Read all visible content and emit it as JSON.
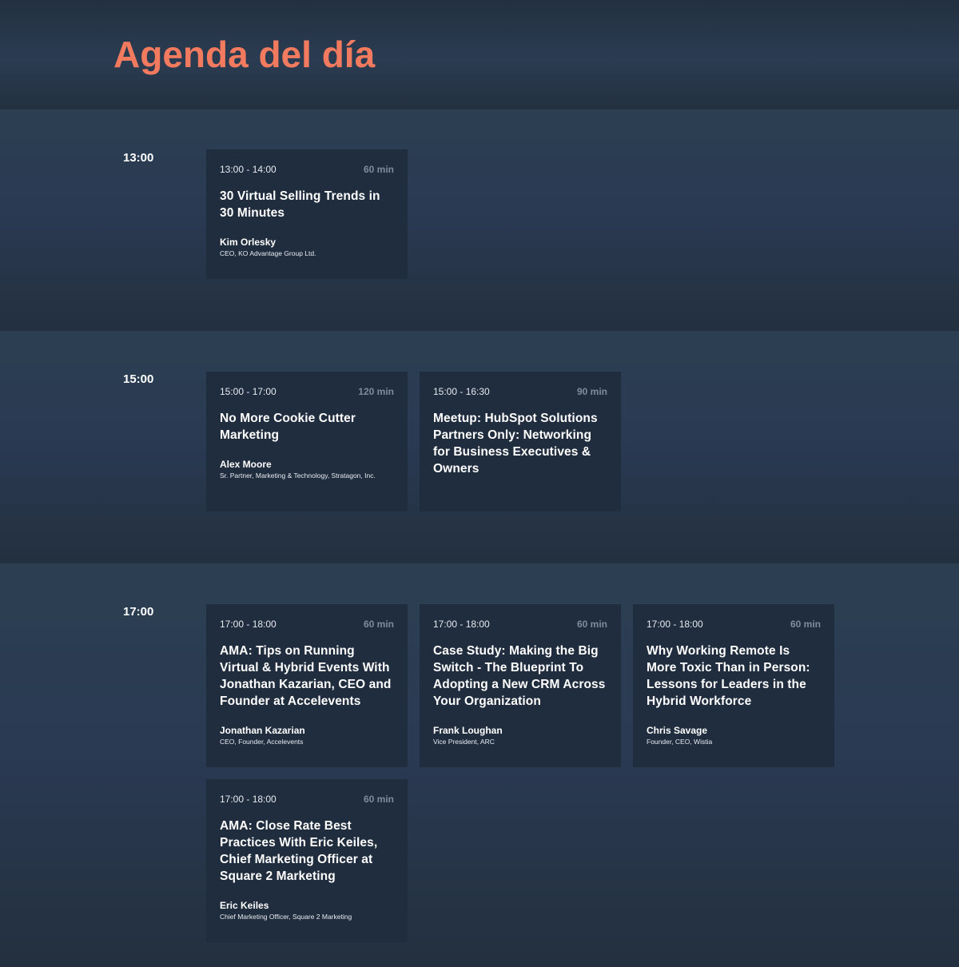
{
  "page": {
    "title": "Agenda del día"
  },
  "blocks": [
    {
      "time": "13:00",
      "sessions": [
        {
          "range": "13:00 - 14:00",
          "duration": "60 min",
          "title": "30 Virtual Selling Trends in 30 Minutes",
          "speaker": "Kim Orlesky",
          "role": "CEO, KO Advantage Group Ltd."
        }
      ]
    },
    {
      "time": "15:00",
      "sessions": [
        {
          "range": "15:00 - 17:00",
          "duration": "120 min",
          "title": "No More Cookie Cutter Marketing",
          "speaker": "Alex Moore",
          "role": "Sr. Partner, Marketing & Technology, Stratagon, Inc."
        },
        {
          "range": "15:00 - 16:30",
          "duration": "90 min",
          "title": "Meetup: HubSpot Solutions Partners Only: Networking for Business Executives & Owners",
          "speaker": "",
          "role": ""
        }
      ]
    },
    {
      "time": "17:00",
      "sessions": [
        {
          "range": "17:00 - 18:00",
          "duration": "60 min",
          "title": "AMA: Tips on Running Virtual & Hybrid Events With Jonathan Kazarian, CEO and Founder at Accelevents",
          "speaker": "Jonathan Kazarian",
          "role": "CEO, Founder, Accelevents"
        },
        {
          "range": "17:00 - 18:00",
          "duration": "60 min",
          "title": "Case Study: Making the Big Switch - The Blueprint To Adopting a New CRM Across Your Organization",
          "speaker": "Frank Loughan",
          "role": "Vice President, ARC"
        },
        {
          "range": "17:00 - 18:00",
          "duration": "60 min",
          "title": "Why Working Remote Is More Toxic Than in Person: Lessons for Leaders in the Hybrid Workforce",
          "speaker": "Chris Savage",
          "role": "Founder, CEO, Wistia"
        },
        {
          "range": "17:00 - 18:00",
          "duration": "60 min",
          "title": "AMA: Close Rate Best Practices With Eric Keiles, Chief Marketing Officer at Square 2 Marketing",
          "speaker": "Eric Keiles",
          "role": "Chief Marketing Officer, Square 2 Marketing"
        }
      ]
    }
  ]
}
